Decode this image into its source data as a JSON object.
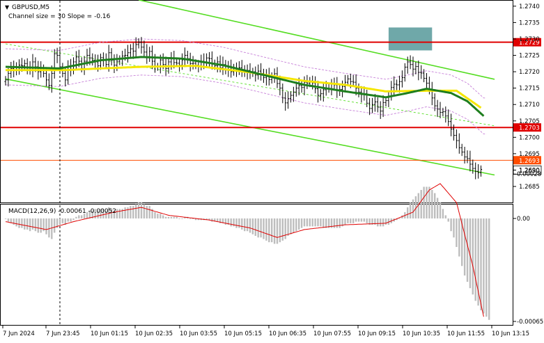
{
  "chart_data": [
    {
      "type": "candlestick",
      "symbol": "GBPUSD,M5",
      "subtitle": "Channel size = 30 Slope = -0.16",
      "ylim": [
        1.26815,
        1.27405
      ],
      "y_ticks": [
        "1.2740",
        "1.2735",
        "1.2730",
        "1.2725",
        "1.2720",
        "1.2715",
        "1.2710",
        "1.2705",
        "1.2700",
        "1.2695",
        "1.2690",
        "1.2685"
      ],
      "x_ticks": [
        "7 Jun 2024",
        "7 Jun 23:45",
        "10 Jun 01:15",
        "10 Jun 02:35",
        "10 Jun 03:55",
        "10 Jun 05:15",
        "10 Jun 06:35",
        "10 Jun 07:55",
        "10 Jun 09:15",
        "10 Jun 10:35",
        "10 Jun 11:55",
        "10 Jun 13:15"
      ],
      "levels": [
        {
          "label": "1.2729",
          "value": 1.2729,
          "color": "#e00000"
        },
        {
          "label": "1.2703",
          "value": 1.2703,
          "color": "#e00000"
        }
      ],
      "last_price": {
        "label": "1.2693",
        "value": 1.2693,
        "color": "#ff4d00"
      },
      "current_price": {
        "label": "1.2690",
        "value": 1.269
      },
      "highlight_zone": {
        "price_top": 1.27335,
        "price_bottom": 1.27265,
        "bar_start": 141,
        "bar_end": 157,
        "color": "#5f9ea0"
      },
      "channel_upper": {
        "start": [
          49,
          1.27419
        ],
        "end": [
          180,
          1.27177
        ],
        "color": "#55dd22"
      },
      "channel_lower": {
        "start": [
          0,
          1.27178
        ],
        "end": [
          180,
          1.26885
        ],
        "color": "#55dd22"
      },
      "channel_mid": {
        "start": [
          0,
          1.27285
        ],
        "end": [
          180,
          1.27035
        ],
        "color": "#55dd22"
      },
      "closes": [
        1.27175,
        1.27195,
        1.2721,
        1.27205,
        1.27215,
        1.2722,
        1.27218,
        1.27225,
        1.27212,
        1.27205,
        1.2723,
        1.27215,
        1.272,
        1.2721,
        1.27195,
        1.27175,
        1.27158,
        1.27195,
        1.27255,
        1.2725,
        1.27215,
        1.27195,
        1.27175,
        1.27215,
        1.27208,
        1.2723,
        1.27245,
        1.27232,
        1.2721,
        1.27232,
        1.2725,
        1.27242,
        1.27235,
        1.2723,
        1.27218,
        1.27243,
        1.27236,
        1.27222,
        1.27258,
        1.27235,
        1.2722,
        1.27232,
        1.27238,
        1.27248,
        1.2725,
        1.27258,
        1.2727,
        1.27263,
        1.27283,
        1.2729,
        1.27275,
        1.2726,
        1.27246,
        1.27262,
        1.27232,
        1.27215,
        1.27215,
        1.27236,
        1.27222,
        1.2721,
        1.2723,
        1.27242,
        1.27228,
        1.27226,
        1.2722,
        1.27236,
        1.2725,
        1.2724,
        1.27225,
        1.27226,
        1.2722,
        1.27218,
        1.27232,
        1.2723,
        1.27242,
        1.2724,
        1.27225,
        1.27218,
        1.2723,
        1.27212,
        1.27222,
        1.27208,
        1.27215,
        1.272,
        1.27212,
        1.27204,
        1.27212,
        1.27206,
        1.272,
        1.27204,
        1.27196,
        1.272,
        1.2719,
        1.27202,
        1.27195,
        1.27182,
        1.2719,
        1.27176,
        1.27186,
        1.27194,
        1.27164,
        1.2715,
        1.2712,
        1.27105,
        1.27118,
        1.27128,
        1.27138,
        1.2715,
        1.27158,
        1.27152,
        1.27168,
        1.27165,
        1.27172,
        1.27166,
        1.27148,
        1.27128,
        1.27133,
        1.27145,
        1.2715,
        1.27148,
        1.27162,
        1.2716,
        1.27142,
        1.27146,
        1.27155,
        1.27168,
        1.27178,
        1.2717,
        1.27168,
        1.2715,
        1.27138,
        1.2713,
        1.27133,
        1.27104,
        1.27088,
        1.271,
        1.27108,
        1.27092,
        1.2708,
        1.27106,
        1.27112,
        1.27126,
        1.27152,
        1.27162,
        1.2716,
        1.2717,
        1.27182,
        1.27214,
        1.2723,
        1.27222,
        1.27208,
        1.27216,
        1.27198,
        1.27196,
        1.2718,
        1.27165,
        1.27145,
        1.2712,
        1.27096,
        1.27086,
        1.27076,
        1.27078,
        1.27065,
        1.27048,
        1.27025,
        1.27006,
        1.2699,
        1.26968,
        1.26955,
        1.2694,
        1.26935,
        1.26918,
        1.26905,
        1.26896,
        1.26892,
        1.26902
      ],
      "ma_yellow": {
        "bars": [
          0,
          22,
          35,
          50,
          70,
          90,
          110,
          125,
          140,
          155,
          166,
          175
        ],
        "values": [
          1.27205,
          1.27205,
          1.2721,
          1.27215,
          1.27218,
          1.27198,
          1.27172,
          1.2716,
          1.2714,
          1.27142,
          1.27142,
          1.2709
        ],
        "color": "#f5e600"
      },
      "ma_green": {
        "bars": [
          0,
          20,
          35,
          50,
          65,
          80,
          95,
          110,
          125,
          140,
          148,
          155,
          164,
          170,
          176
        ],
        "values": [
          1.27215,
          1.2721,
          1.27235,
          1.27245,
          1.2724,
          1.2722,
          1.2719,
          1.2716,
          1.2714,
          1.27122,
          1.27135,
          1.27148,
          1.27135,
          1.2711,
          1.27065
        ],
        "color": "#1e7e1e"
      },
      "envelope_dashed": {
        "color": "#c67fd8"
      },
      "vline_bar": 20
    },
    {
      "type": "histogram",
      "title": "MACD(12,26,9) -0.00061 -0.00052",
      "y_ticks": [
        "0.00028",
        "0.00",
        "-0.00065"
      ],
      "ylim": [
        -0.00065,
        0.00028
      ],
      "histogram": [
        -0.0,
        -2e-05,
        -3e-05,
        -4e-05,
        -5e-05,
        -6e-05,
        -6e-05,
        -7e-05,
        -7e-05,
        -8e-05,
        -7e-05,
        -8e-05,
        -9e-05,
        -9e-05,
        -8e-05,
        -0.0001,
        -0.00012,
        -0.00013,
        -9e-05,
        -6e-05,
        -4e-05,
        -3e-05,
        -4e-05,
        -2e-05,
        -2e-05,
        -1e-05,
        1e-05,
        2e-05,
        2e-05,
        3e-05,
        4e-05,
        5e-05,
        5e-05,
        6e-05,
        5e-05,
        6e-05,
        6e-05,
        5e-05,
        7e-05,
        6e-05,
        5e-05,
        6e-05,
        6e-05,
        6e-05,
        7e-05,
        7e-05,
        8e-05,
        8e-05,
        9e-05,
        0.0001,
        0.0001,
        9e-05,
        8e-05,
        8e-05,
        6e-05,
        4e-05,
        3e-05,
        3e-05,
        2e-05,
        1e-05,
        1e-05,
        1e-05,
        1e-05,
        1e-05,
        0.0,
        0.0,
        1e-05,
        1e-05,
        0.0,
        0.0,
        -1e-05,
        -1e-05,
        -1e-05,
        -1e-05,
        -1e-05,
        -1e-05,
        -2e-05,
        -2e-05,
        -2e-05,
        -3e-05,
        -3e-05,
        -4e-05,
        -4e-05,
        -5e-05,
        -5e-05,
        -6e-05,
        -6e-05,
        -7e-05,
        -8e-05,
        -8e-05,
        -9e-05,
        -0.0001,
        -0.00011,
        -0.00012,
        -0.00012,
        -0.00013,
        -0.00014,
        -0.00015,
        -0.00015,
        -0.00016,
        -0.00016,
        -0.00015,
        -0.00014,
        -0.00013,
        -0.00011,
        -0.0001,
        -9e-05,
        -8e-05,
        -7e-05,
        -6e-05,
        -5e-05,
        -5e-05,
        -5e-05,
        -5e-05,
        -5e-05,
        -5e-05,
        -5e-05,
        -6e-05,
        -6e-05,
        -6e-05,
        -6e-05,
        -6e-05,
        -6e-05,
        -6e-05,
        -5e-05,
        -4e-05,
        -3e-05,
        -3e-05,
        -3e-05,
        -2e-05,
        -2e-05,
        -2e-05,
        -2e-05,
        -3e-05,
        -4e-05,
        -4e-05,
        -4e-05,
        -5e-05,
        -5e-05,
        -5e-05,
        -4e-05,
        -4e-05,
        -3e-05,
        -2e-05,
        -1e-05,
        0.0,
        2e-05,
        4e-05,
        7e-05,
        0.0001,
        0.00012,
        0.00014,
        0.00016,
        0.00018,
        0.0002,
        0.0002,
        0.0002,
        0.00018,
        0.00016,
        0.00013,
        0.0001,
        6e-05,
        2e-05,
        -2e-05,
        -8e-05,
        -0.00012,
        -0.00018,
        -0.00024,
        -0.0003,
        -0.00036,
        -0.0004,
        -0.00044,
        -0.00048,
        -0.00052,
        -0.00055,
        -0.00058,
        -0.0006,
        -0.00062,
        -0.00064
      ],
      "signal": {
        "bars": [
          0,
          15,
          25,
          40,
          50,
          60,
          75,
          90,
          100,
          110,
          125,
          140,
          150,
          156,
          160,
          166,
          172,
          176
        ],
        "values": [
          -2e-05,
          -7e-05,
          -2e-05,
          4e-05,
          7e-05,
          2e-05,
          -1e-05,
          -6e-05,
          -0.00012,
          -7e-05,
          -4e-05,
          -3e-05,
          4e-05,
          0.00018,
          0.00022,
          0.0001,
          -0.0003,
          -0.00062
        ],
        "color": "#e00000"
      }
    }
  ]
}
